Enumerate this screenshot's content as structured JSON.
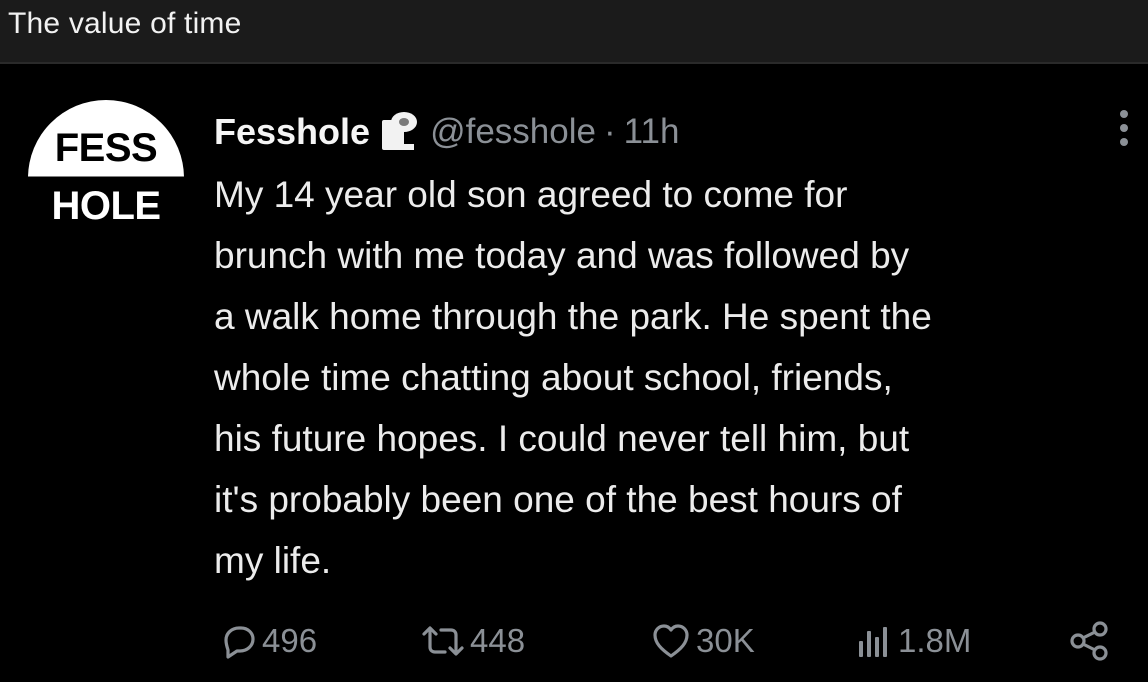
{
  "post": {
    "title": "The value of time"
  },
  "tweet": {
    "avatar": {
      "top_text": "FESS",
      "bottom_text": "HOLE"
    },
    "display_name": "Fesshole",
    "badge_icon": "toilet-roll-icon",
    "handle": "@fesshole",
    "separator": "·",
    "time": "11h",
    "text_lines": [
      "My 14 year old son agreed to come for",
      "brunch with me today and was followed by",
      "a walk home through the park. He spent the",
      "whole time chatting about school, friends,",
      "his future hopes. I could never tell him, but",
      "it's probably been one of the best hours of",
      "my life."
    ],
    "actions": {
      "reply": {
        "icon": "reply-icon",
        "count": "496"
      },
      "retweet": {
        "icon": "retweet-icon",
        "count": "448"
      },
      "like": {
        "icon": "heart-icon",
        "count": "30K"
      },
      "views": {
        "icon": "views-icon",
        "count": "1.8M"
      },
      "share": {
        "icon": "share-icon"
      }
    },
    "colors": {
      "background": "#000000",
      "text": "#e7e9ea",
      "muted": "#8b9096"
    }
  }
}
